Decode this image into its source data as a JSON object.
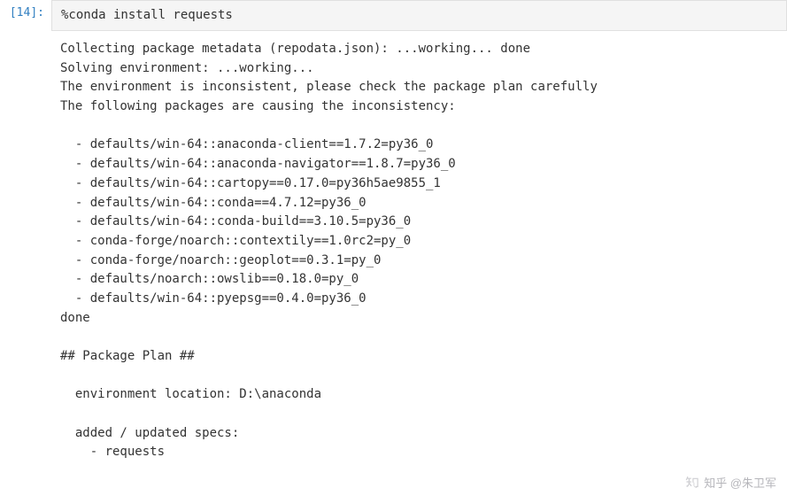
{
  "cell": {
    "execution_count": "[14]:",
    "input_code": "%conda install requests"
  },
  "output": {
    "lines": [
      "Collecting package metadata (repodata.json): ...working... done",
      "Solving environment: ...working...",
      "The environment is inconsistent, please check the package plan carefully",
      "The following packages are causing the inconsistency:",
      "",
      "  - defaults/win-64::anaconda-client==1.7.2=py36_0",
      "  - defaults/win-64::anaconda-navigator==1.8.7=py36_0",
      "  - defaults/win-64::cartopy==0.17.0=py36h5ae9855_1",
      "  - defaults/win-64::conda==4.7.12=py36_0",
      "  - defaults/win-64::conda-build==3.10.5=py36_0",
      "  - conda-forge/noarch::contextily==1.0rc2=py_0",
      "  - conda-forge/noarch::geoplot==0.3.1=py_0",
      "  - defaults/noarch::owslib==0.18.0=py_0",
      "  - defaults/win-64::pyepsg==0.4.0=py36_0",
      "done",
      "",
      "## Package Plan ##",
      "",
      "  environment location: D:\\anaconda",
      "",
      "  added / updated specs:",
      "    - requests"
    ]
  },
  "watermark": {
    "text": "知乎 @朱卫军"
  }
}
